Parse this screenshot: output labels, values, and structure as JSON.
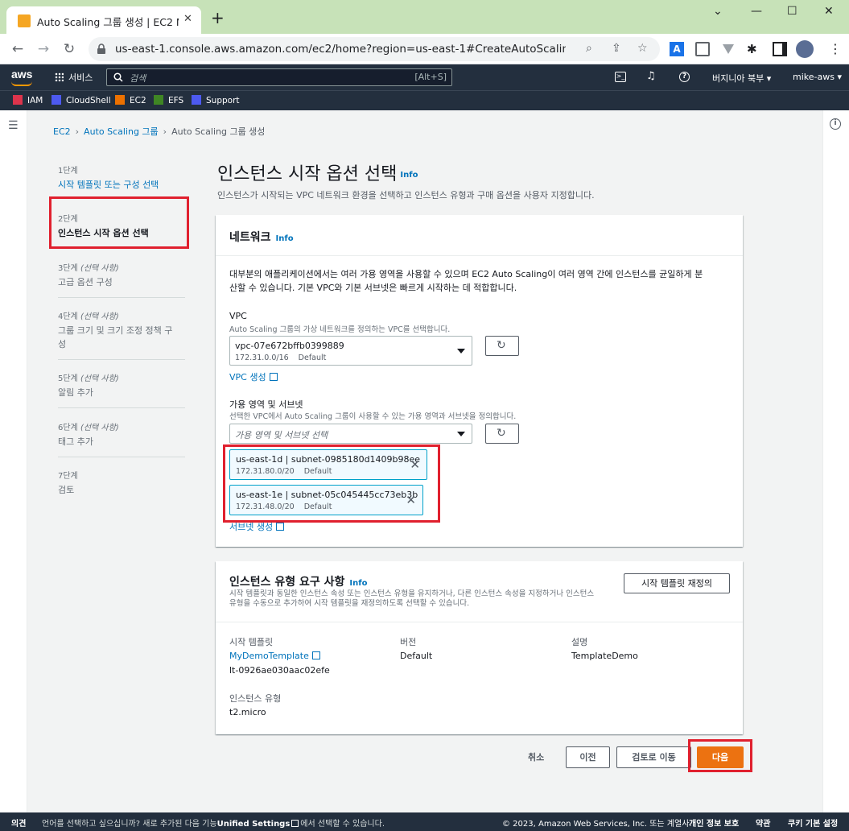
{
  "browser": {
    "tab_title": "Auto Scaling 그룹 생성 | EC2 M",
    "url": "us-east-1.console.aws.amazon.com/ec2/home?region=us-east-1#CreateAutoScalingGroup:"
  },
  "aws_header": {
    "logo": "aws",
    "services": "서비스",
    "search_placeholder": "검색",
    "search_shortcut": "[Alt+S]",
    "region": "버지니아 북부 ▾",
    "account": "mike-aws ▾"
  },
  "favorites": [
    {
      "label": "IAM",
      "color": "#dd344c"
    },
    {
      "label": "CloudShell",
      "color": "#4d5af0"
    },
    {
      "label": "EC2",
      "color": "#ed7100"
    },
    {
      "label": "EFS",
      "color": "#3f8624"
    },
    {
      "label": "Support",
      "color": "#4d5af0"
    }
  ],
  "breadcrumb": {
    "items": [
      "EC2",
      "Auto Scaling 그룹"
    ],
    "current": "Auto Scaling 그룹 생성"
  },
  "steps": [
    {
      "num": "1단계",
      "title": "시작 템플릿 또는 구성 선택"
    },
    {
      "num": "2단계",
      "title": "인스턴스 시작 옵션 선택"
    },
    {
      "num": "3단계",
      "opt": "(선택 사항)",
      "title": "고급 옵션 구성"
    },
    {
      "num": "4단계",
      "opt": "(선택 사항)",
      "title": "그룹 크기 및 크기 조정 정책 구",
      "title2": "성"
    },
    {
      "num": "5단계",
      "opt": "(선택 사항)",
      "title": "알림 추가"
    },
    {
      "num": "6단계",
      "opt": "(선택 사항)",
      "title": "태그 추가"
    },
    {
      "num": "7단계",
      "title": "검토"
    }
  ],
  "page": {
    "title": "인스턴스 시작 옵션 선택",
    "info": "Info",
    "description": "인스턴스가 시작되는 VPC 네트워크 환경을 선택하고 인스턴스 유형과 구매 옵션을 사용자 지정합니다."
  },
  "network": {
    "heading": "네트워크",
    "info": "Info",
    "intro1": "대부분의 애플리케이션에서는 여러 가용 영역을 사용할 수 있으며 EC2 Auto Scaling이 여러 영역 간에 인스턴스를 균일하게 분",
    "intro2": "산할 수 있습니다. 기본 VPC와 기본 서브넷은 빠르게 시작하는 데 적합합니다.",
    "vpc_label": "VPC",
    "vpc_desc": "Auto Scaling 그룹의 가상 네트워크를 정의하는 VPC를 선택합니다.",
    "vpc_id": "vpc-07e672bffb0399889",
    "vpc_cidr": "172.31.0.0/16",
    "vpc_default": "Default",
    "create_vpc": "VPC 생성",
    "az_label": "가용 영역 및 서브넷",
    "az_desc": "선택한 VPC에서 Auto Scaling 그룹이 사용할 수 있는 가용 영역과 서브넷을 정의합니다.",
    "az_placeholder": "가용 영역 및 서브넷 선택",
    "subnets": [
      {
        "name": "us-east-1d | subnet-0985180d1409b98ee",
        "cidr": "172.31.80.0/20",
        "tag": "Default"
      },
      {
        "name": "us-east-1e | subnet-05c045445cc73eb3b",
        "cidr": "172.31.48.0/20",
        "tag": "Default"
      }
    ],
    "create_subnet": "서브넷 생성"
  },
  "instance_type": {
    "heading": "인스턴스 유형 요구 사항",
    "info": "Info",
    "desc1": "시작 템플릿과 동일한 인스턴스 속성 또는 인스턴스 유형을 유지하거나, 다른 인스턴스 속성을 지정하거나 인스턴스",
    "desc2": "유형을 수동으로 추가하여 시작 템플릿을 재정의하도록 선택할 수 있습니다.",
    "override_button": "시작 템플릿 재정의",
    "col_template": "시작 템플릿",
    "template_name": "MyDemoTemplate",
    "template_id": "lt-0926ae030aac02efe",
    "col_version": "버전",
    "version": "Default",
    "col_description": "설명",
    "description": "TemplateDemo",
    "type_label": "인스턴스 유형",
    "type_value": "t2.micro"
  },
  "actions": {
    "cancel": "취소",
    "previous": "이전",
    "skip_review": "검토로 이동",
    "next": "다음"
  },
  "footer": {
    "feedback": "의견",
    "language_note": "언어를 선택하고 싶으십니까? 새로 추가된 다음 기능",
    "unified": "Unified Settings",
    "language_note2": "에서 선택할 수 있습니다.",
    "copyright": "© 2023, Amazon Web Services, Inc. 또는 계열사.",
    "privacy": "개인 정보 보호",
    "terms": "약관",
    "cookies": "쿠키 기본 설정"
  }
}
